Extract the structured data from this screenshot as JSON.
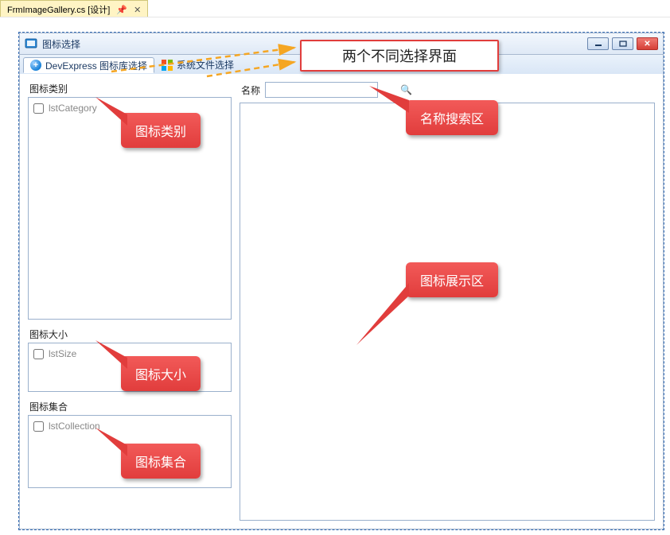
{
  "document_tab": {
    "filename": "FrmImageGallery.cs [设计]"
  },
  "window": {
    "title": "图标选择"
  },
  "tabs": {
    "dx_library": "DevExpress 图标库选择",
    "system_files": "系统文件选择"
  },
  "left_panel": {
    "category_label": "图标类别",
    "category_item": "lstCategory",
    "size_label": "图标大小",
    "size_item": "lstSize",
    "collection_label": "图标集合",
    "collection_item": "lstCollection"
  },
  "search": {
    "label": "名称",
    "value": "",
    "placeholder": ""
  },
  "callouts": {
    "top_box": "两个不同选择界面",
    "category": "图标类别",
    "size": "图标大小",
    "collection": "图标集合",
    "search_area": "名称搜索区",
    "gallery_area": "图标展示区"
  }
}
